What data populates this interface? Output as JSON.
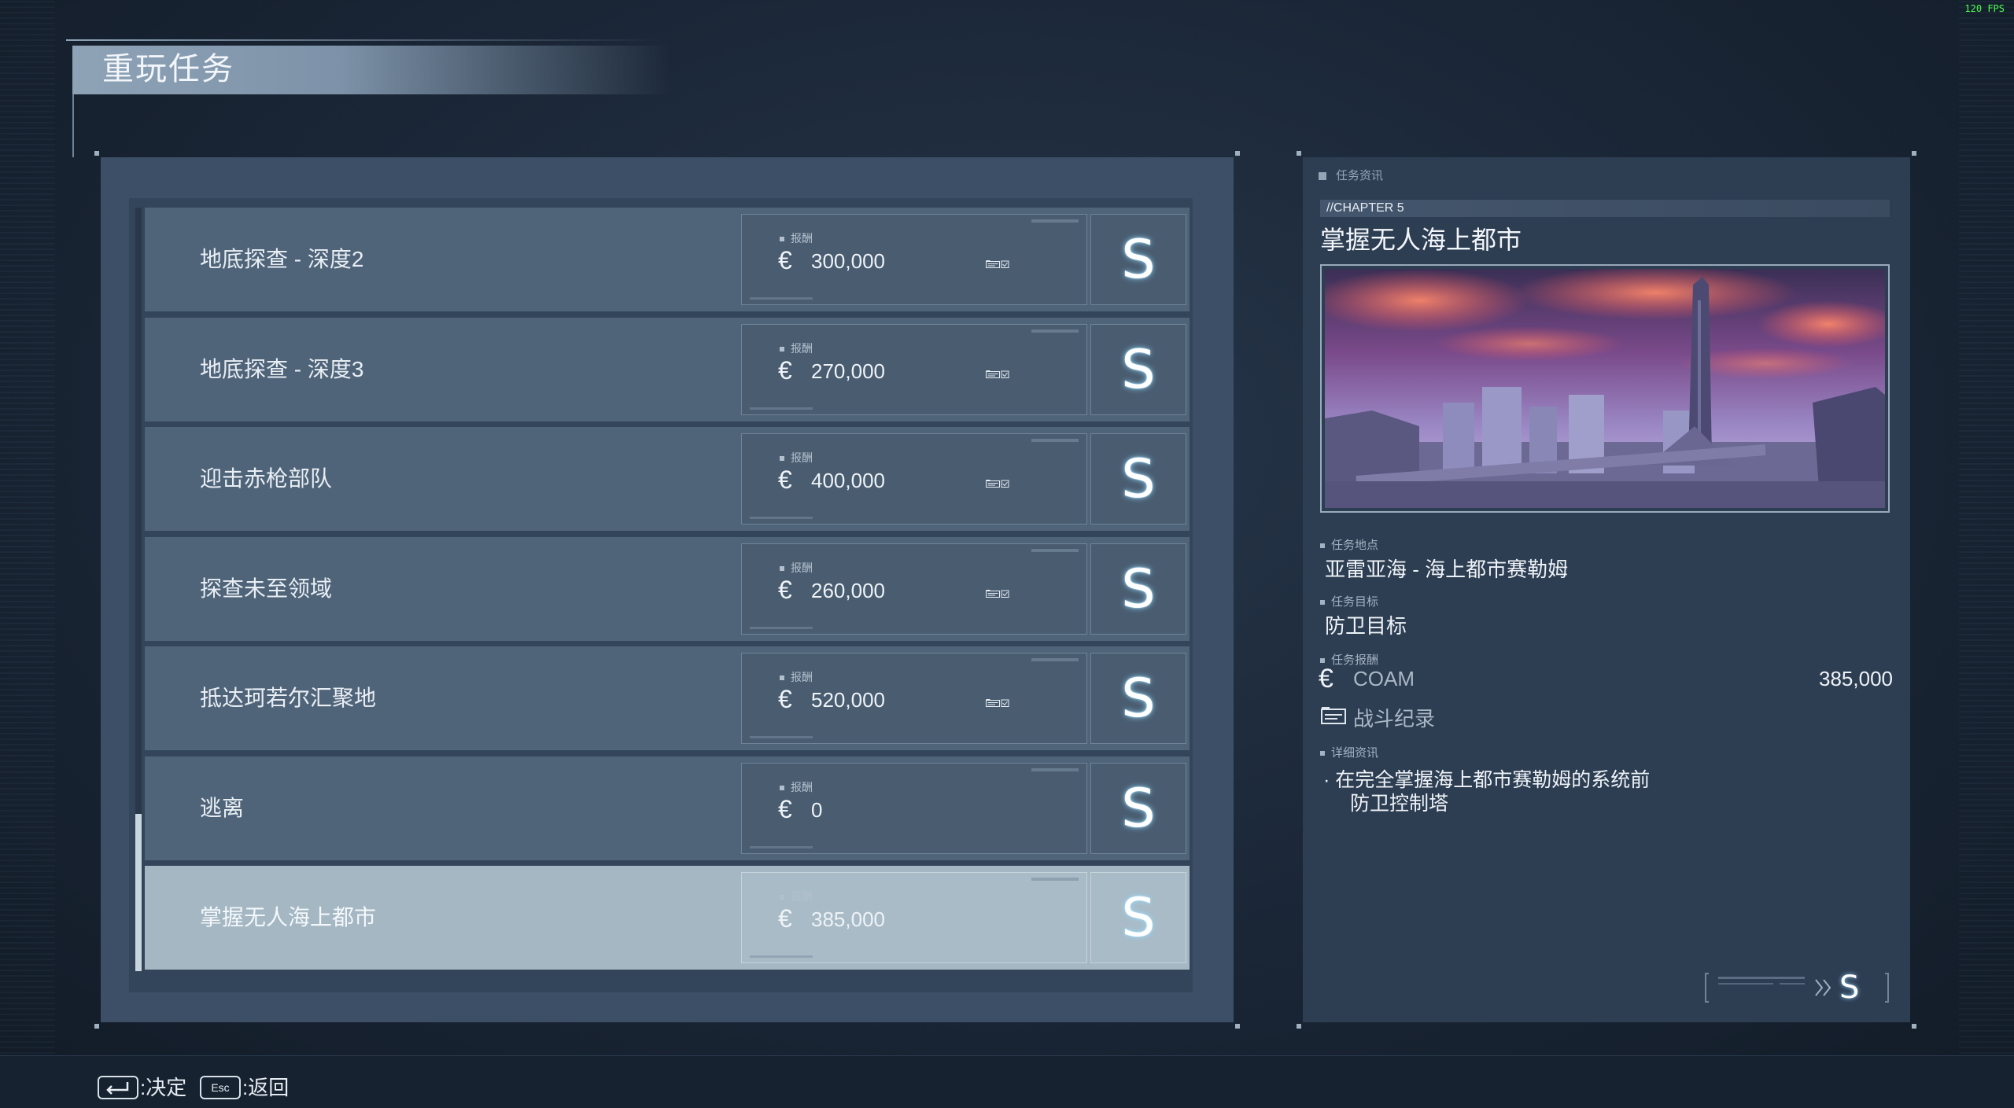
{
  "fps": "120 FPS",
  "page_title": "重玩任务",
  "reward_label": "报酬",
  "currency_symbol": "€",
  "rank_letter": "S",
  "missions": [
    {
      "name": "地底探查 - 深度2",
      "reward": "300,000",
      "has_log": true,
      "selected": false
    },
    {
      "name": "地底探查 - 深度3",
      "reward": "270,000",
      "has_log": true,
      "selected": false
    },
    {
      "name": "迎击赤枪部队",
      "reward": "400,000",
      "has_log": true,
      "selected": false
    },
    {
      "name": "探查未至领域",
      "reward": "260,000",
      "has_log": true,
      "selected": false
    },
    {
      "name": "抵达珂若尔汇聚地",
      "reward": "520,000",
      "has_log": true,
      "selected": false
    },
    {
      "name": "逃离",
      "reward": "0",
      "has_log": false,
      "selected": false
    },
    {
      "name": "掌握无人海上都市",
      "reward": "385,000",
      "has_log": false,
      "selected": true
    }
  ],
  "info": {
    "header": "任务资讯",
    "chapter": "//CHAPTER 5",
    "title": "掌握无人海上都市",
    "location_label": "任务地点",
    "location": "亚雷亚海 - 海上都市赛勒姆",
    "objective_label": "任务目标",
    "objective": "防卫目标",
    "reward_label": "任务报酬",
    "reward_source": "COAM",
    "reward_value": "385,000",
    "combat_log": "战斗纪录",
    "detail_label": "详细资讯",
    "detail_line1": "· 在完全掌握海上都市赛勒姆的系统前",
    "detail_line2": "防卫控制塔",
    "rank": "S"
  },
  "footer": {
    "confirm_key": "⏎",
    "confirm_label": ":决定",
    "back_key": "Esc",
    "back_label": ":返回"
  },
  "colors": {
    "panel": "#3c4f66",
    "row": "#506479",
    "row_selected": "#a4b7c3",
    "rank_glow": "#96dcff"
  }
}
